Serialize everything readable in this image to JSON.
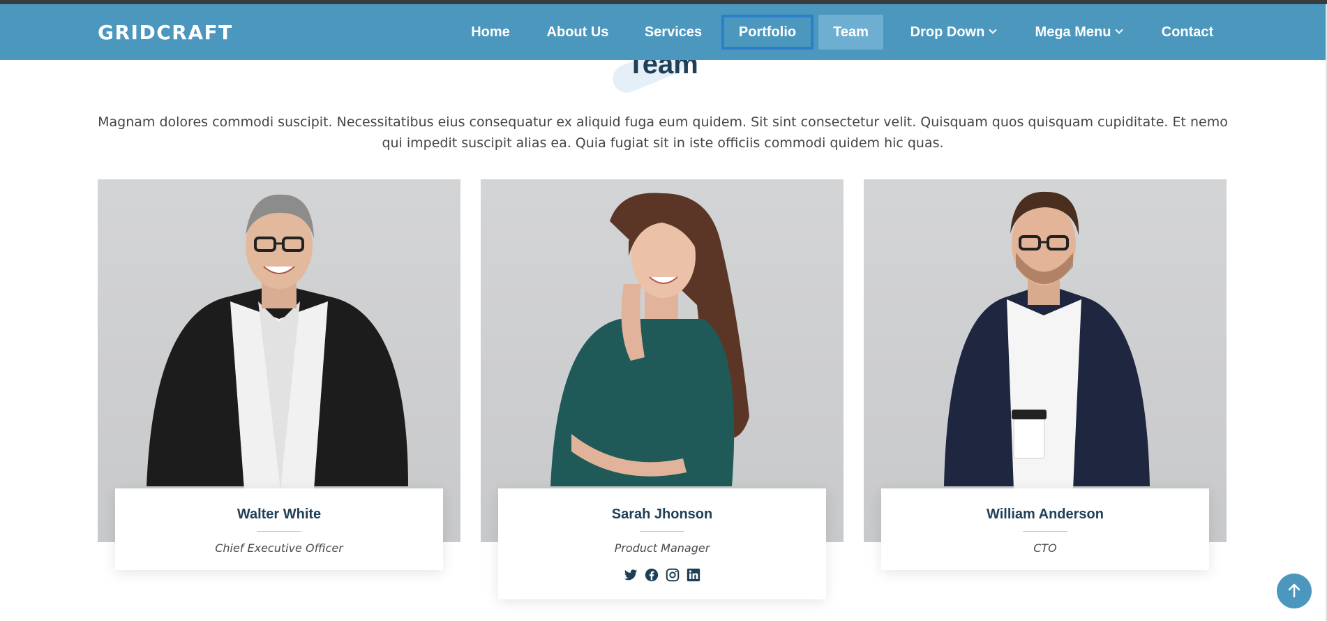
{
  "header": {
    "logo": "GRIDCRAFT",
    "nav": [
      {
        "label": "Home"
      },
      {
        "label": "About Us"
      },
      {
        "label": "Services"
      },
      {
        "label": "Portfolio"
      },
      {
        "label": "Team"
      },
      {
        "label": "Drop Down"
      },
      {
        "label": "Mega Menu"
      },
      {
        "label": "Contact"
      }
    ]
  },
  "section": {
    "title": "Team",
    "description": "Magnam dolores commodi suscipit. Necessitatibus eius consequatur ex aliquid fuga eum quidem. Sit sint consectetur velit. Quisquam quos quisquam cupiditate. Et nemo qui impedit suscipit alias ea. Quia fugiat sit in iste officiis commodi quidem hic quas."
  },
  "members": [
    {
      "name": "Walter White",
      "role": "Chief Executive Officer"
    },
    {
      "name": "Sarah Jhonson",
      "role": "Product Manager"
    },
    {
      "name": "William Anderson",
      "role": "CTO"
    }
  ],
  "social_icons": [
    "twitter-icon",
    "facebook-icon",
    "instagram-icon",
    "linkedin-icon"
  ],
  "colors": {
    "header_bg": "#4b97be",
    "nav_active_bg": "#6eaed0",
    "focus_ring": "#2b7fc9",
    "title": "#1f3f57",
    "icon": "#1f3f57"
  }
}
